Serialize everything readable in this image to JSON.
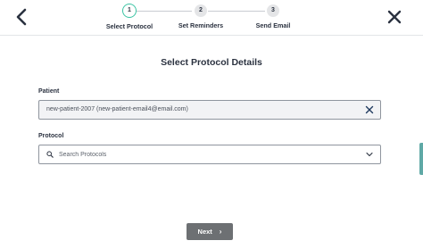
{
  "header": {
    "back_icon": "chevron-left-icon",
    "close_icon": "close-icon"
  },
  "stepper": {
    "steps": [
      {
        "number": "1",
        "label": "Select Protocol",
        "state": "active"
      },
      {
        "number": "2",
        "label": "Set Reminders",
        "state": "pending"
      },
      {
        "number": "3",
        "label": "Send Email",
        "state": "pending"
      }
    ]
  },
  "main": {
    "title": "Select Protocol Details",
    "patient": {
      "label": "Patient",
      "value": "new-patient-2007 (new-patient-email4@email.com)",
      "clear_icon": "close-icon"
    },
    "protocol": {
      "label": "Protocol",
      "placeholder": "Search Protocols",
      "value": "",
      "search_icon": "search-icon",
      "dropdown_icon": "chevron-down-icon"
    },
    "next_button": {
      "label": "Next",
      "icon": "chevron-right-icon"
    }
  },
  "colors": {
    "accent": "#3cc4a4",
    "button_bg": "#6d7073",
    "text": "#2b3240"
  }
}
